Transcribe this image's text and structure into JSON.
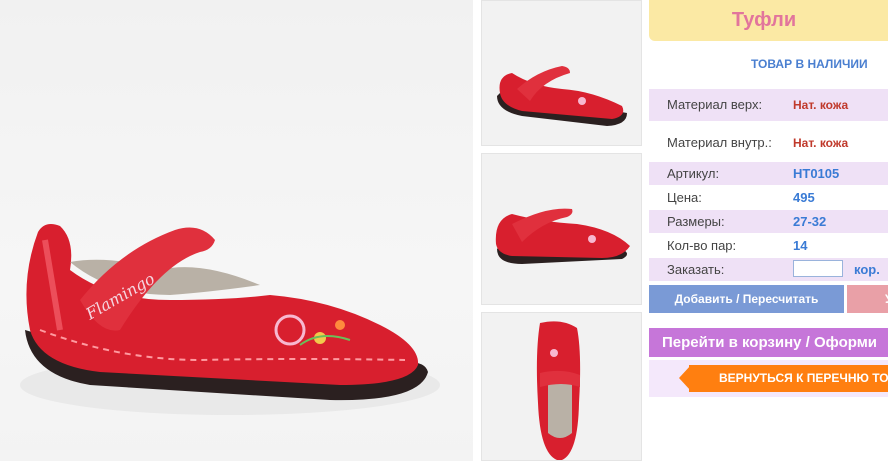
{
  "product": {
    "title": "Туфли",
    "availability": "ТОВАР В НАЛИЧИИ",
    "brand_on_shoe": "Flamingo",
    "details": {
      "material_upper_label": "Материал верх:",
      "material_upper_value": "Нат. кожа",
      "material_inner_label": "Материал внутр.:",
      "material_inner_value": "Нат. кожа",
      "article_label": "Артикул:",
      "article_value": "HT0105",
      "price_label": "Цена:",
      "price_value": "495",
      "sizes_label": "Размеры:",
      "sizes_value": "27-32",
      "pairs_label": "Кол-во пар:",
      "pairs_value": "14"
    },
    "order": {
      "label": "Заказать:",
      "value": "",
      "unit": "кор."
    }
  },
  "actions": {
    "add_label": "Добавить / Пересчитать",
    "delete_label": "У",
    "cart_label": "Перейти в корзину / Оформи",
    "back_label": "ВЕРНУТЬСЯ К ПЕРЕЧНЮ ТОВ"
  },
  "colors": {
    "title_bg": "#fbe9a4",
    "title_text": "#e2759c",
    "accent_blue": "#3a7bd5",
    "label_red": "#c0392b",
    "cart_purple": "#c676d9",
    "back_orange": "#ff7f10",
    "shoe_red": "#d81f2e"
  }
}
